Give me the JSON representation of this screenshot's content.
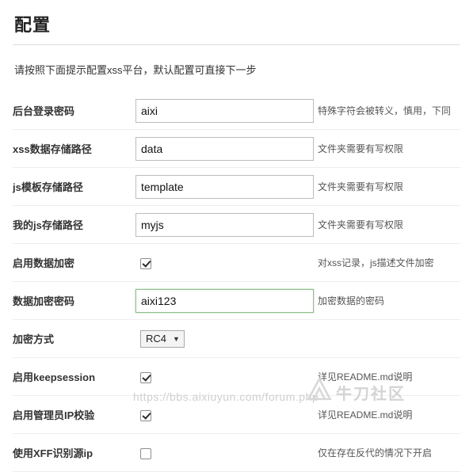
{
  "page": {
    "title": "配置",
    "intro": "请按照下面提示配置xss平台，默认配置可直接下一步"
  },
  "rows": [
    {
      "label": "后台登录密码",
      "type": "text",
      "value": "aixi",
      "placeholder": "",
      "hint": "特殊字符会被转义，慎用，下同",
      "focused": false
    },
    {
      "label": "xss数据存储路径",
      "type": "text",
      "value": "data",
      "placeholder": "",
      "hint": "文件夹需要有写权限",
      "focused": false
    },
    {
      "label": "js模板存储路径",
      "type": "text",
      "value": "template",
      "placeholder": "",
      "hint": "文件夹需要有写权限",
      "focused": false
    },
    {
      "label": "我的js存储路径",
      "type": "text",
      "value": "myjs",
      "placeholder": "",
      "hint": "文件夹需要有写权限",
      "focused": false
    },
    {
      "label": "启用数据加密",
      "type": "checkbox",
      "checked": true,
      "hint": "对xss记录，js描述文件加密"
    },
    {
      "label": "数据加密密码",
      "type": "text",
      "value": "aixi123",
      "placeholder": "",
      "hint": "加密数据的密码",
      "focused": true
    },
    {
      "label": "加密方式",
      "type": "select",
      "value": "RC4",
      "options": [
        "RC4"
      ],
      "hint": ""
    },
    {
      "label": "启用keepsession",
      "type": "checkbox",
      "checked": true,
      "hint": "详见README.md说明"
    },
    {
      "label": "启用管理员IP校验",
      "type": "checkbox",
      "checked": true,
      "hint": "详见README.md说明"
    },
    {
      "label": "使用XFF识别源ip",
      "type": "checkbox",
      "checked": false,
      "hint": "仅在存在反代的情况下开启"
    }
  ],
  "watermark": {
    "url": "https://bbs.aixiuyun.com/forum.php",
    "brand": "牛刀社区"
  }
}
